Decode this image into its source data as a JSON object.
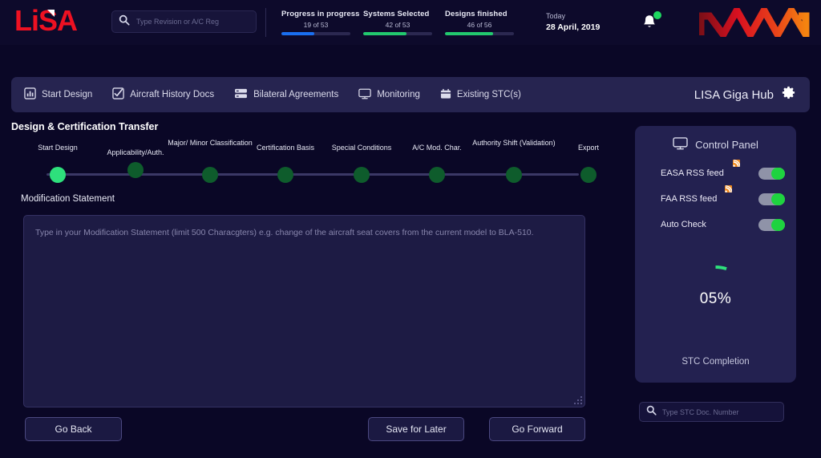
{
  "header": {
    "logo_text": "LiSA",
    "search": {
      "value": "",
      "placeholder": "Type Revision or A/C Reg"
    },
    "stats": [
      {
        "title": "Progress in progress",
        "sub": "19  of 53",
        "percent": 48,
        "color": "#1a6ff0"
      },
      {
        "title": "Systems Selected",
        "sub": "42 of 53",
        "percent": 63,
        "color": "#22c96e"
      },
      {
        "title": "Designs finished",
        "sub": "46 of 56",
        "percent": 70,
        "color": "#22c96e"
      }
    ],
    "today_label": "Today",
    "today_value": "28 April, 2019",
    "notification_icon": "bell-icon",
    "brand_mark": "zigzag-logo"
  },
  "nav": {
    "items": [
      {
        "label": "Start Design",
        "icon": "bar-chart-icon"
      },
      {
        "label": "Aircraft History Docs",
        "icon": "checkbox-check-icon"
      },
      {
        "label": "Bilateral Agreements",
        "icon": "server-icon"
      },
      {
        "label": "Monitoring",
        "icon": "monitor-icon"
      },
      {
        "label": "Existing STC(s)",
        "icon": "briefcase-icon"
      }
    ],
    "hub_label": "LISA Giga Hub",
    "settings_icon": "gear-icon"
  },
  "main": {
    "section_title": "Design & Certification Transfer",
    "steps": [
      {
        "label": "Start Design",
        "active": true
      },
      {
        "label": "Applicability/Auth.",
        "active": false
      },
      {
        "label": "Major/ Minor Classification",
        "active": false
      },
      {
        "label": "Certification Basis",
        "active": false
      },
      {
        "label": "Special Conditions",
        "active": false
      },
      {
        "label": "A/C Mod. Char.",
        "active": false
      },
      {
        "label": "Authority Shift (Validation)",
        "active": false
      },
      {
        "label": "Export",
        "active": false
      }
    ],
    "modification_label": "Modification Statement",
    "modification_value": "",
    "modification_placeholder": "Type in your Modification Statement (limit 500 Characgters) e.g. change of the aircraft seat covers from the current model to BLA-510.",
    "buttons": {
      "back": "Go Back",
      "save": "Save for Later",
      "forward": "Go Forward"
    }
  },
  "control_panel": {
    "title": "Control Panel",
    "title_icon": "monitor-icon",
    "rows": [
      {
        "label": "EASA RSS feed",
        "badge": "rss-icon",
        "on": true
      },
      {
        "label": "FAA RSS feed",
        "badge": "rss-icon",
        "on": true
      },
      {
        "label": "Auto Check",
        "badge": null,
        "on": true
      }
    ],
    "gauge_percent_label": "05%",
    "gauge_percent_value": 5,
    "gauge_caption": "STC Completion",
    "gauge_color": "#2ee07c",
    "stc_search": {
      "value": "",
      "placeholder": "Type STC Doc. Number"
    }
  }
}
